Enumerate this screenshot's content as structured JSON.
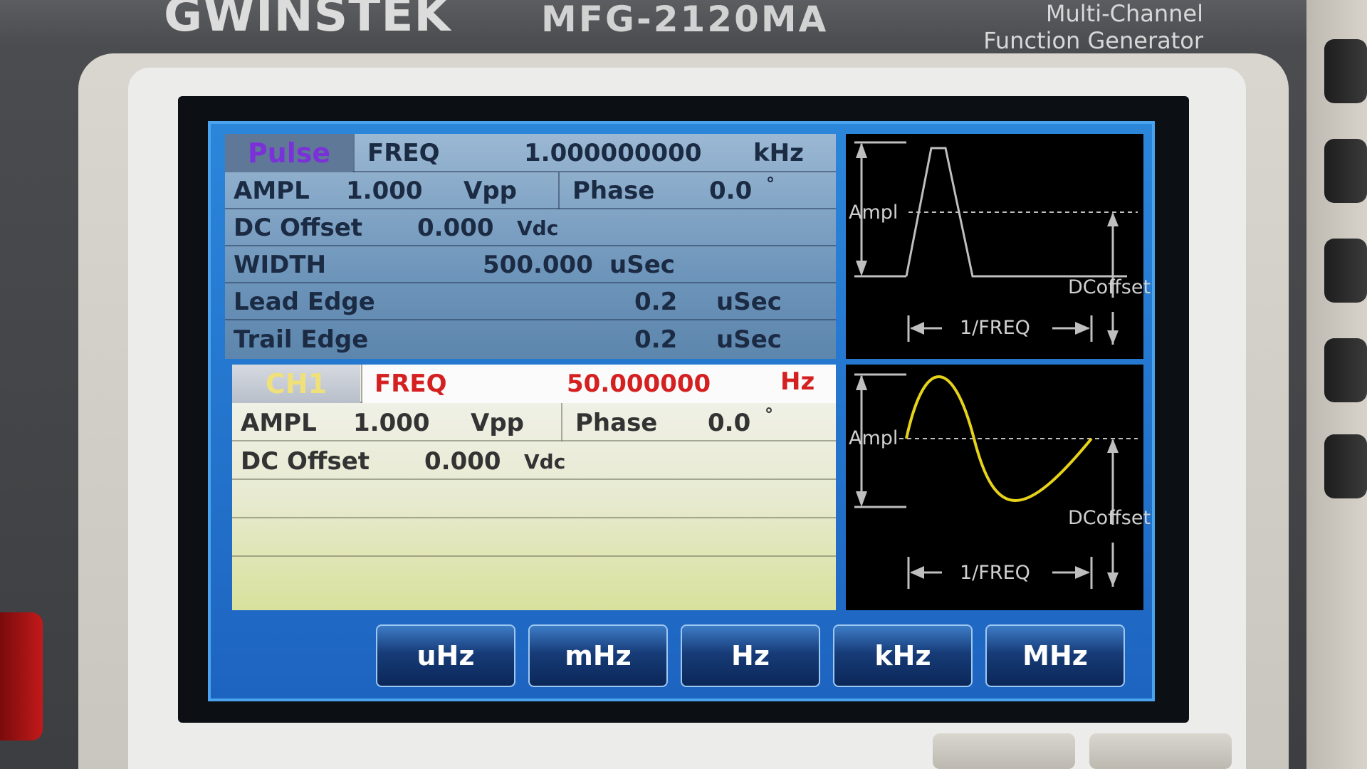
{
  "device": {
    "brand": "GWINSTEK",
    "model": "MFG-2120MA",
    "description_line1": "Multi-Channel",
    "description_line2": "Function  Generator"
  },
  "pulse_panel": {
    "waveform": "Pulse",
    "freq_label": "FREQ",
    "freq_value": "1.000000000",
    "freq_unit": "kHz",
    "ampl_label": "AMPL",
    "ampl_value": "1.000",
    "ampl_unit": "Vpp",
    "phase_label": "Phase",
    "phase_value": "0.0",
    "phase_unit": "°",
    "dc_label": "DC Offset",
    "dc_value": "0.000",
    "dc_unit": "Vdc",
    "width_label": "WIDTH",
    "width_value": "500.000",
    "width_unit": "uSec",
    "lead_label": "Lead Edge",
    "lead_value": "0.2",
    "lead_unit": "uSec",
    "trail_label": "Trail Edge",
    "trail_value": "0.2",
    "trail_unit": "uSec"
  },
  "ch1_panel": {
    "channel": "CH1",
    "freq_label": "FREQ",
    "freq_value": "50.000000",
    "freq_unit": "Hz",
    "ampl_label": "AMPL",
    "ampl_value": "1.000",
    "ampl_unit": "Vpp",
    "phase_label": "Phase",
    "phase_value": "0.0",
    "phase_unit": "°",
    "dc_label": "DC Offset",
    "dc_value": "0.000",
    "dc_unit": "Vdc"
  },
  "wave_labels": {
    "ampl": "Ampl",
    "dcoffset": "DCoffset",
    "period": "1/FREQ"
  },
  "soft_keys": [
    "uHz",
    "mHz",
    "Hz",
    "kHz",
    "MHz"
  ],
  "colors": {
    "screen_blue": "#1d64c0",
    "active_red": "#d42020",
    "sine_yellow": "#e6d21a",
    "pulse_tag_purple": "#7a32d8"
  }
}
